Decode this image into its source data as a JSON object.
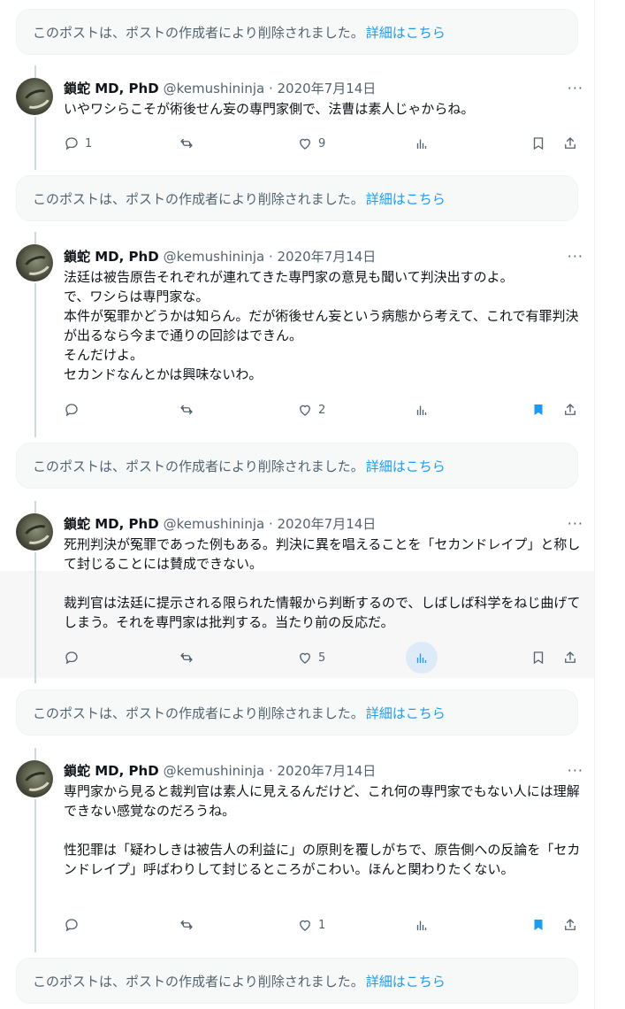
{
  "deleted_notice": {
    "text": "このポストは、ポストの作成者により削除されました。",
    "link": "詳細はこちら"
  },
  "colors": {
    "accent": "#1d9bf0",
    "muted": "#536471",
    "bookmark_active": "#1d9bf0"
  },
  "posts": [
    {
      "author": "鎖蛇 MD, PhD",
      "handle": "@kemushininja · 2020年7月14日",
      "more": "···",
      "text": "いやワシらこそが術後せん妄の専門家側で、法曹は素人じゃからね。",
      "replies": "1",
      "retweets": "",
      "likes": "9",
      "bookmarked": false
    },
    {
      "author": "鎖蛇 MD, PhD",
      "handle": "@kemushininja · 2020年7月14日",
      "more": "···",
      "text": "法廷は被告原告それぞれが連れてきた専門家の意見も聞いて判決出すのよ。\nで、ワシらは専門家な。\n本件が冤罪かどうかは知らん。だが術後せん妄という病態から考えて、これで有罪判決が出るなら今まで通りの回診はできん。\nそんだけよ。\nセカンドなんとかは興味ないわ。",
      "replies": "",
      "retweets": "",
      "likes": "2",
      "bookmarked": true
    },
    {
      "author": "鎖蛇 MD, PhD",
      "handle": "@kemushininja · 2020年7月14日",
      "more": "···",
      "text": "死刑判決が冤罪であった例もある。判決に異を唱えることを「セカンドレイプ」と称して封じることには賛成できない。\n\n裁判官は法廷に提示される限られた情報から判断するので、しばしば科学をねじ曲げてしまう。それを専門家は批判する。当たり前の反応だ。",
      "replies": "",
      "retweets": "",
      "likes": "5",
      "bookmarked": false
    },
    {
      "author": "鎖蛇 MD, PhD",
      "handle": "@kemushininja · 2020年7月14日",
      "more": "···",
      "text": "専門家から見ると裁判官は素人に見えるんだけど、これ何の専門家でもない人には理解できない感覚なのだろうね。\n\n性犯罪は「疑わしきは被告人の利益に」の原則を覆しがちで、原告側への反論を「セカンドレイプ」呼ばわりして封じるところがこわい。ほんと関わりたくない。",
      "replies": "",
      "retweets": "",
      "likes": "1",
      "bookmarked": true
    }
  ]
}
